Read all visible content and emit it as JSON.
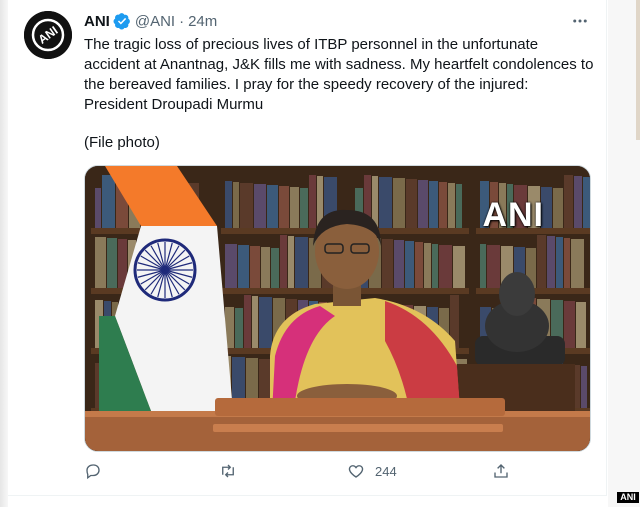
{
  "tweet": {
    "author_name": "ANI",
    "handle": "@ANI",
    "separator": "·",
    "time": "24m",
    "text_line1": "The tragic loss of precious lives of ITBP personnel in the unfortunate accident at Anantnag, J&K fills me with sadness. My heartfelt condolences to the bereaved families. I pray for the speedy recovery of the injured: President Droupadi Murmu",
    "file_note": "(File photo)",
    "media_watermark": "ANI",
    "avatar_text": "ANI"
  },
  "actions": {
    "reply_icon": "reply-icon",
    "retweet_icon": "retweet-icon",
    "like_icon": "heart-icon",
    "like_count": "244",
    "share_icon": "share-icon"
  },
  "corner_badge": "ANI",
  "colors": {
    "verified": "#1d9bf0",
    "secondary_text": "#536471",
    "saffron": "#f47a2a",
    "green": "#2e7d4f",
    "navy": "#1f2a7a"
  }
}
